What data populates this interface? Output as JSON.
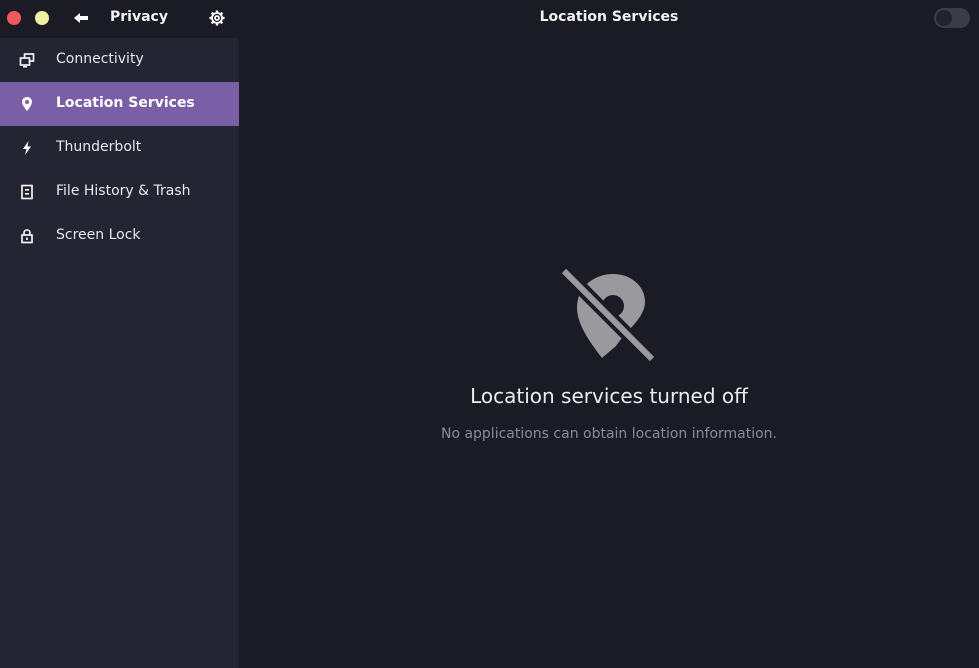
{
  "sidebar": {
    "title": "Privacy",
    "window_controls": [
      "close",
      "minimize"
    ],
    "back_icon": "arrow-left-icon",
    "settings_icon": "gear-icon",
    "items": [
      {
        "label": "Connectivity",
        "icon": "connectivity-icon",
        "active": false
      },
      {
        "label": "Location Services",
        "icon": "location-pin-icon",
        "active": true
      },
      {
        "label": "Thunderbolt",
        "icon": "lightning-icon",
        "active": false
      },
      {
        "label": "File History & Trash",
        "icon": "file-history-icon",
        "active": false
      },
      {
        "label": "Screen Lock",
        "icon": "lock-icon",
        "active": false
      }
    ]
  },
  "main": {
    "title": "Location Services",
    "toggle_state": "off",
    "empty_state": {
      "icon": "location-disabled-icon",
      "title": "Location services turned off",
      "subtitle": "No applications can obtain location information."
    }
  },
  "colors": {
    "accent": "#7b5fa6",
    "close": "#ee5a5a",
    "minimize": "#f1f0a1",
    "background": "#1b1b26",
    "sidebar": "#242432"
  }
}
